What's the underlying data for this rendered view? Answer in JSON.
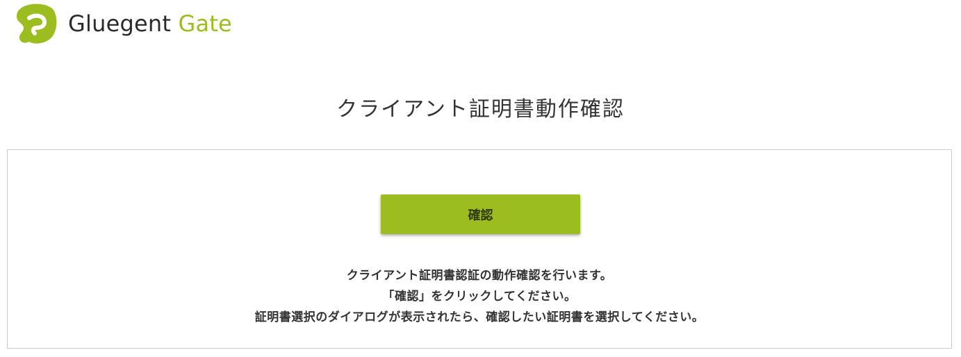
{
  "header": {
    "logo_icon": "gluegent-logo-icon",
    "brand_word1": "Gluegent",
    "brand_word2": "Gate",
    "brand_color": "#9bbd1f"
  },
  "main": {
    "title": "クライアント証明書動作確認",
    "confirm_label": "確認",
    "messages": [
      "クライアント証明書認証の動作確認を行います。",
      "「確認」をクリックしてください。",
      "証明書選択のダイアログが表示されたら、確認したい証明書を選択してください。"
    ]
  }
}
